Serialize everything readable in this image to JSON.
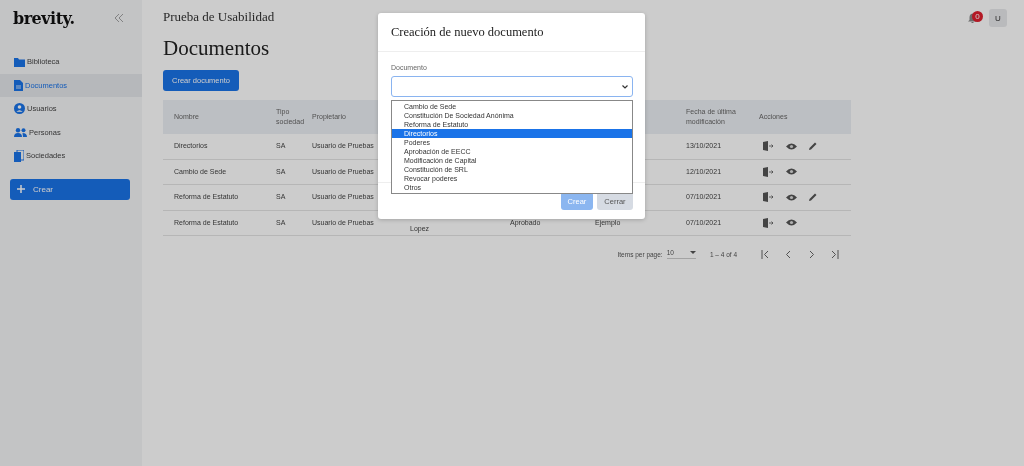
{
  "sidebar": {
    "logo": "brevity.",
    "items": [
      {
        "label": "Biblioteca",
        "selected": false
      },
      {
        "label": "Documentos",
        "selected": true
      },
      {
        "label": "Usuarios",
        "selected": false
      },
      {
        "label": "Personas",
        "selected": false
      },
      {
        "label": "Sociedades",
        "selected": false
      }
    ],
    "create_button": "Crear"
  },
  "header": {
    "title": "Prueba de Usabilidad",
    "notification_count": "0",
    "avatar": "U"
  },
  "page": {
    "heading": "Documentos",
    "create_button": "Crear documento"
  },
  "table": {
    "columns": {
      "nombre": "Nombre",
      "tipo": "Tipo sociedad",
      "propietario": "Propietario",
      "fecha": "Fecha de última modificación",
      "acciones": "Acciones"
    },
    "rows": [
      {
        "nombre": "Directorios",
        "tipo": "SA",
        "propietario": "Usuario de Pruebas",
        "fecha": "13/10/2021",
        "editable": true
      },
      {
        "nombre": "Cambio de Sede",
        "tipo": "SA",
        "propietario": "Usuario de Pruebas",
        "fecha": "12/10/2021",
        "editable": false
      },
      {
        "nombre": "Reforma de Estatuto",
        "tipo": "SA",
        "propietario": "Usuario de Pruebas",
        "fecha": "07/10/2021",
        "editable": true
      },
      {
        "nombre": "Reforma de Estatuto",
        "tipo": "SA",
        "propietario": "Usuario de Pruebas",
        "column_4": "Lopez",
        "column_5": "Aprobado",
        "column_6": "Ejemplo",
        "fecha": "07/10/2021",
        "editable": false
      }
    ]
  },
  "pagination": {
    "label": "Items per page:",
    "page_size": "10",
    "range": "1 – 4 of 4"
  },
  "modal": {
    "title": "Creación de nuevo documento",
    "field_label": "Documento",
    "options": [
      {
        "label": "Cambio de Sede",
        "selected": false
      },
      {
        "label": "Constitución De Sociedad Anónima",
        "selected": false
      },
      {
        "label": "Reforma de Estatuto",
        "selected": false
      },
      {
        "label": "Directorios",
        "selected": true
      },
      {
        "label": "Poderes",
        "selected": false
      },
      {
        "label": "Aprobación de EECC",
        "selected": false
      },
      {
        "label": "Modificación de Capital",
        "selected": false
      },
      {
        "label": "Constitución de SRL",
        "selected": false
      },
      {
        "label": "Revocar poderes",
        "selected": false
      },
      {
        "label": "Otros",
        "selected": false
      }
    ],
    "buttons": [
      "Crear",
      "Cerrar"
    ]
  }
}
